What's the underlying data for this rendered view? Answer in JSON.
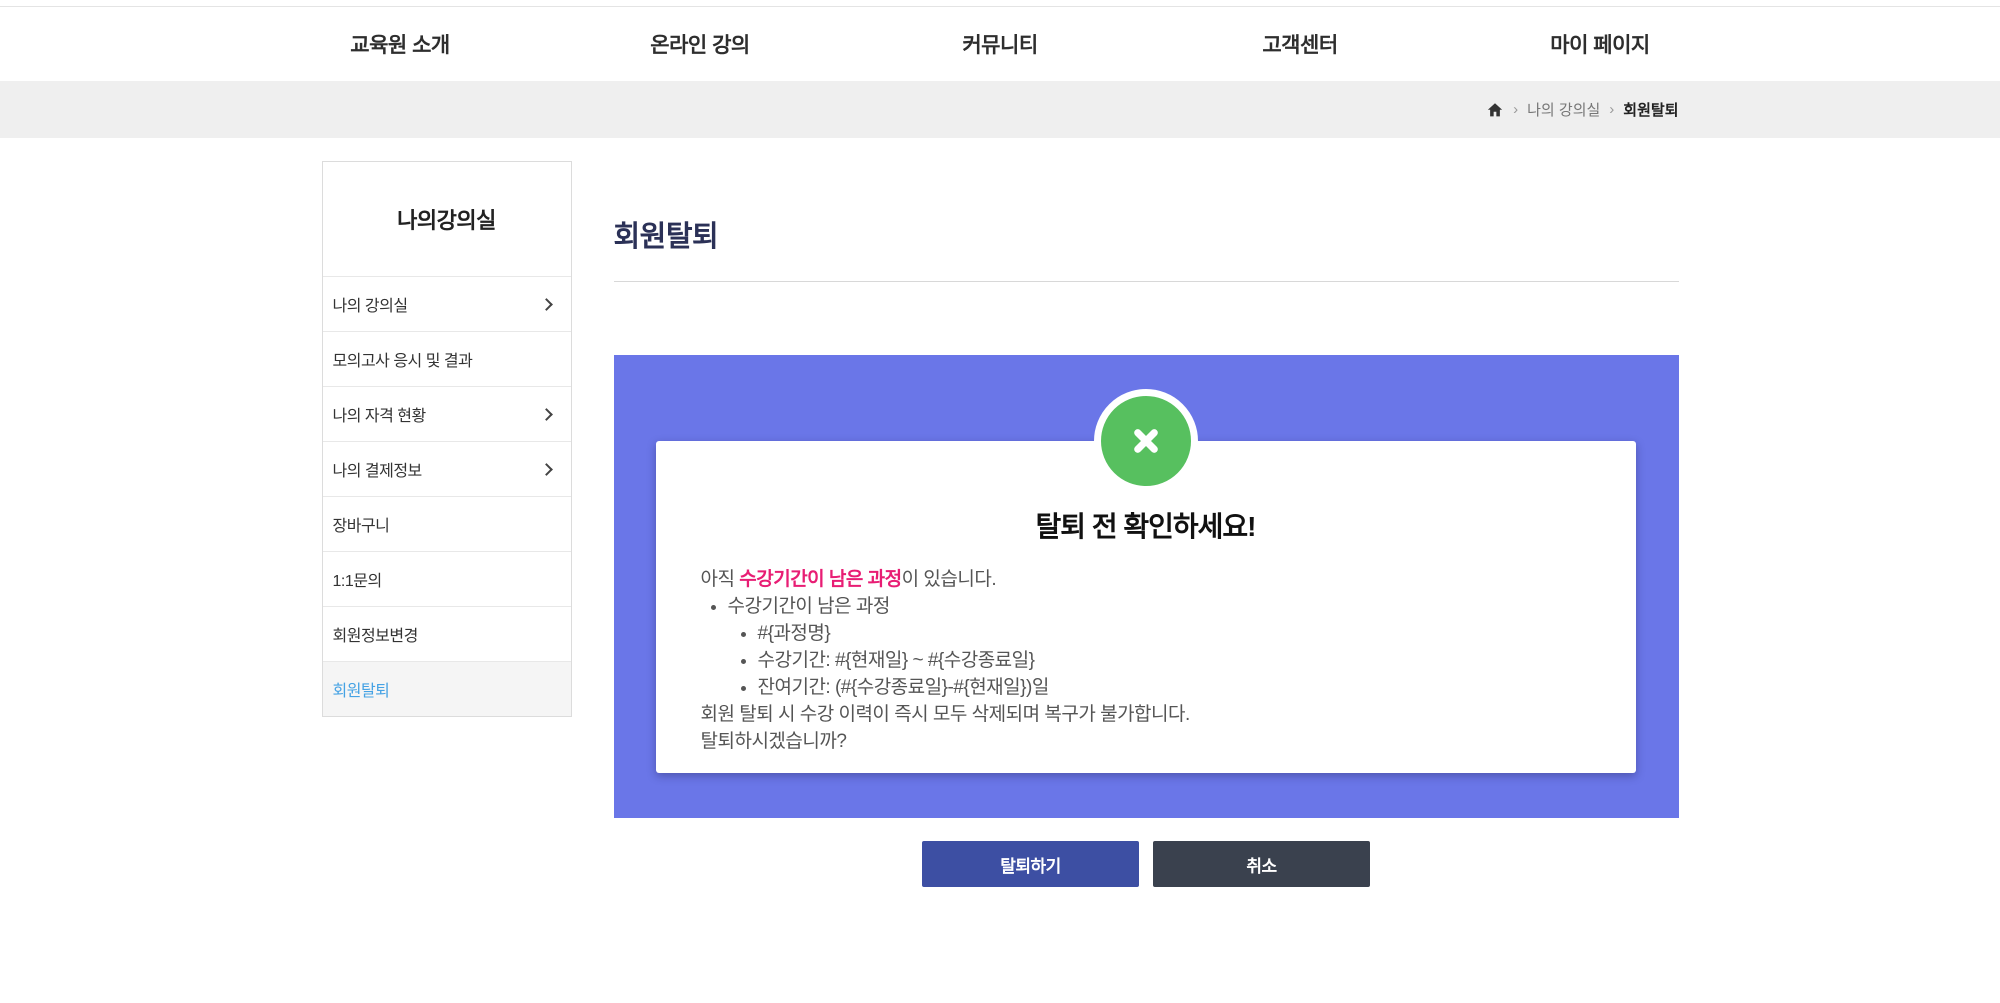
{
  "nav": {
    "items": [
      {
        "label": "교육원 소개"
      },
      {
        "label": "온라인 강의"
      },
      {
        "label": "커뮤니티"
      },
      {
        "label": "고객센터"
      },
      {
        "label": "마이 페이지"
      }
    ]
  },
  "breadcrumb": {
    "separator": "›",
    "items": [
      "나의 강의실",
      "회원탈퇴"
    ]
  },
  "sidebar": {
    "title": "나의강의실",
    "items": [
      {
        "label": "나의 강의실",
        "chevron": true,
        "active": false
      },
      {
        "label": "모의고사 응시 및 결과",
        "chevron": false,
        "active": false
      },
      {
        "label": "나의 자격 현황",
        "chevron": true,
        "active": false
      },
      {
        "label": "나의 결제정보",
        "chevron": true,
        "active": false
      },
      {
        "label": "장바구니",
        "chevron": false,
        "active": false
      },
      {
        "label": "1:1문의",
        "chevron": false,
        "active": false
      },
      {
        "label": "회원정보변경",
        "chevron": false,
        "active": false
      },
      {
        "label": "회원탈퇴",
        "chevron": false,
        "active": true
      }
    ]
  },
  "main": {
    "title": "회원탈퇴",
    "modal": {
      "heading": "탈퇴 전 확인하세요!",
      "intro_prefix": "아직 ",
      "intro_highlight": "수강기간이 남은 과정",
      "intro_suffix": "이 있습니다.",
      "list_item": "수강기간이 남은 과정",
      "sub_items": [
        "#{과정명}",
        "수강기간: #{현재일} ~ #{수강종료일}",
        "잔여기간: (#{수강종료일}-#{현재일})일"
      ],
      "warning": "회원 탈퇴 시 수강 이력이 즉시 모두 삭제되며 복구가 불가합니다.",
      "question": "탈퇴하시겠습니까?"
    },
    "buttons": {
      "withdraw": "탈퇴하기",
      "cancel": "취소"
    }
  },
  "colors": {
    "panel_purple": "#6a76e8",
    "success_green": "#57c05f",
    "highlight_pink": "#e81d74",
    "withdraw_button": "#3d4fa3",
    "cancel_button": "#3a414e",
    "title_navy": "#2b3157",
    "active_link_blue": "#45a2e4",
    "breadcrumb_band": "#efefef"
  }
}
